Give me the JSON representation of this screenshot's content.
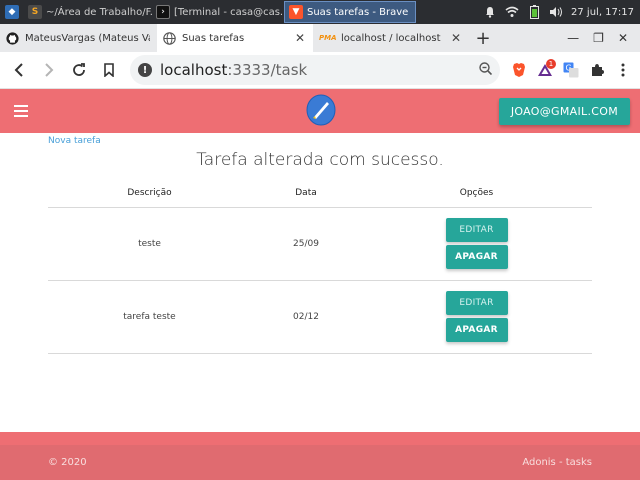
{
  "taskbar": {
    "tasks": [
      {
        "label": "~/Área de Trabalho/F..."
      },
      {
        "label": "[Terminal - casa@cas..."
      },
      {
        "label": "Suas tarefas - Brave"
      }
    ],
    "clock": "27 jul, 17:17"
  },
  "browser": {
    "tabs": [
      {
        "title": "MateusVargas (Mateus Varg"
      },
      {
        "title": "Suas tarefas"
      },
      {
        "title": "localhost / localhost / adon"
      }
    ],
    "url_host": "localhost",
    "url_rest": ":3333/task",
    "extension_badge": "1"
  },
  "app": {
    "user_email": "JOAO@GMAIL.COM",
    "new_task_link": "Nova tarefa",
    "flash_message": "Tarefa alterada com sucesso.",
    "table": {
      "headers": [
        "Descrição",
        "Data",
        "Opções"
      ],
      "rows": [
        {
          "description": "teste",
          "date": "25/09",
          "edit_label": "EDITAR",
          "delete_label": "APAGAR"
        },
        {
          "description": "tarefa teste",
          "date": "02/12",
          "edit_label": "EDITAR",
          "delete_label": "APAGAR"
        }
      ]
    },
    "footer": {
      "copyright": "© 2020",
      "right_text": "Adonis - tasks"
    }
  },
  "colors": {
    "navbar": "#ee6e73",
    "accent": "#26a69a",
    "link": "#4aa0d8"
  }
}
